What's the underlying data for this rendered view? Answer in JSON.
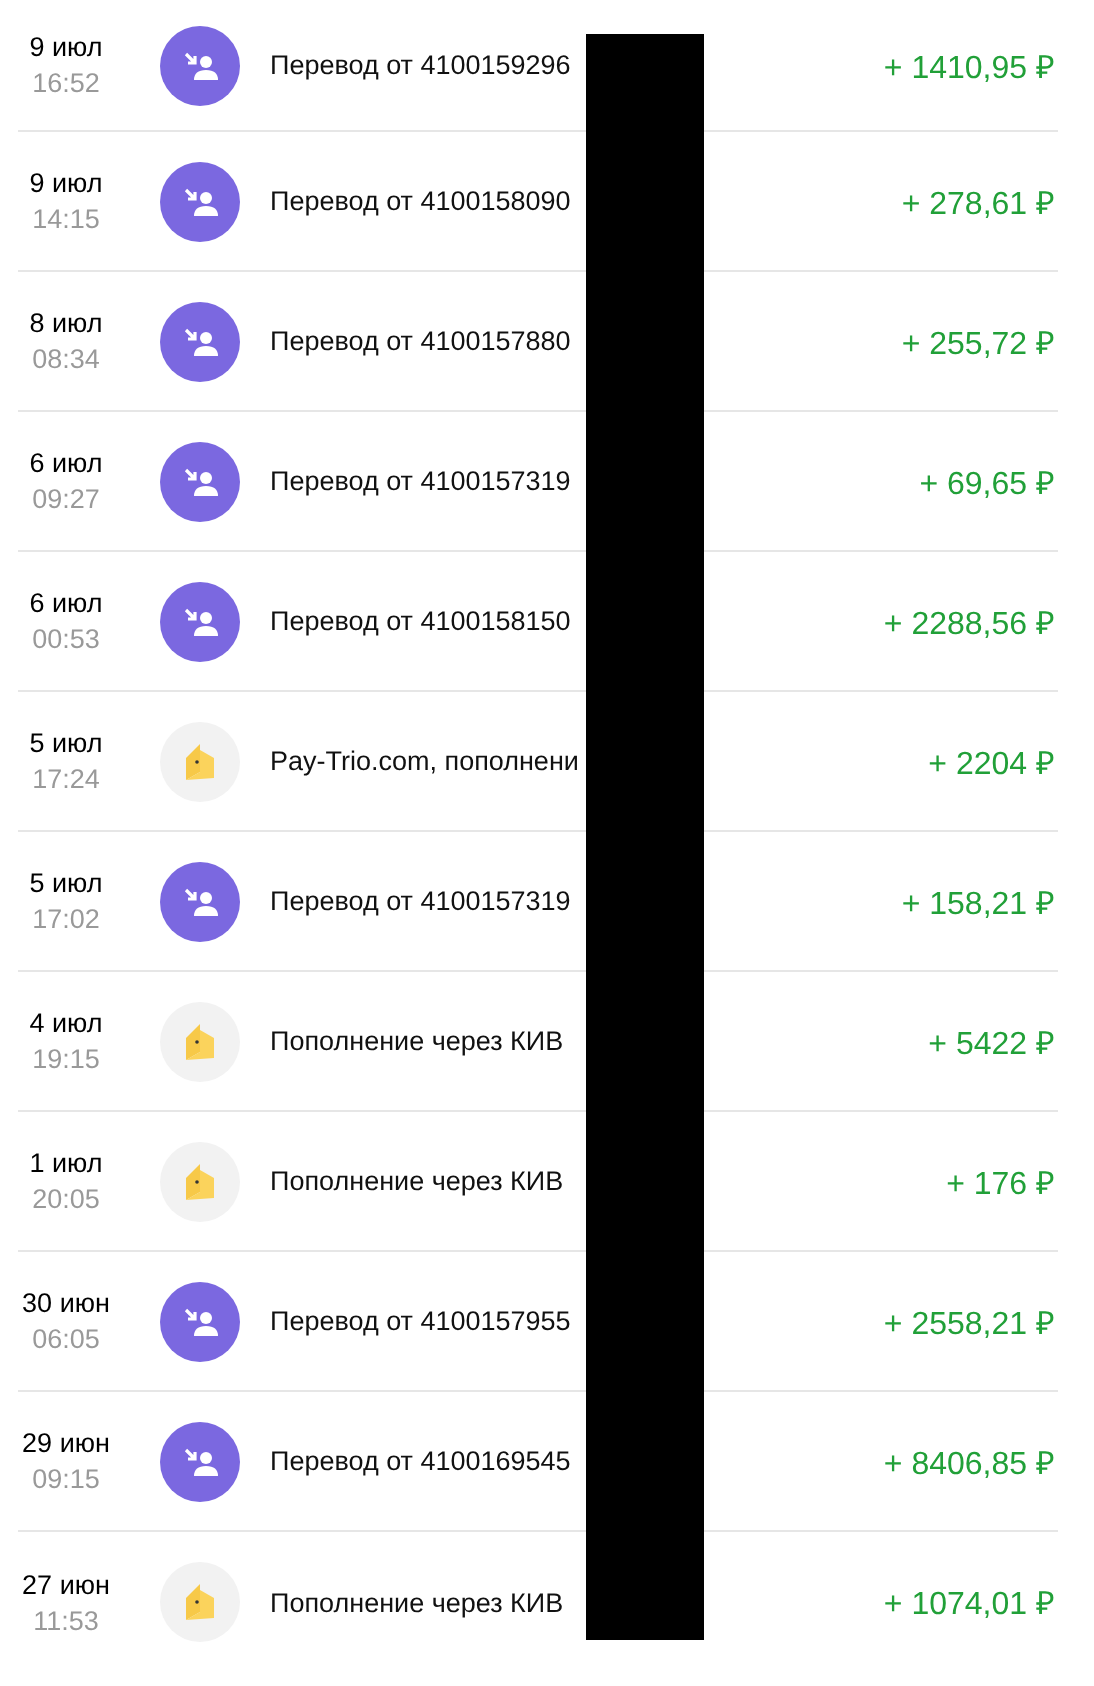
{
  "operations": [
    {
      "kind": "transfer",
      "date": "9 июл",
      "time": "16:52",
      "description": "Перевод от 4100159296",
      "amount": "+ 1410,95 ₽"
    },
    {
      "kind": "transfer",
      "date": "9 июл",
      "time": "14:15",
      "description": "Перевод от 4100158090",
      "amount": "+ 278,61 ₽"
    },
    {
      "kind": "transfer",
      "date": "8 июл",
      "time": "08:34",
      "description": "Перевод от 4100157880",
      "amount": "+ 255,72 ₽"
    },
    {
      "kind": "transfer",
      "date": "6 июл",
      "time": "09:27",
      "description": "Перевод от 4100157319",
      "amount": "+ 69,65 ₽"
    },
    {
      "kind": "transfer",
      "date": "6 июл",
      "time": "00:53",
      "description": "Перевод от 4100158150",
      "amount": "+ 2288,56 ₽"
    },
    {
      "kind": "topup",
      "date": "5 июл",
      "time": "17:24",
      "description": "Pay-Trio.com, пополнени",
      "amount": "+ 2204 ₽"
    },
    {
      "kind": "transfer",
      "date": "5 июл",
      "time": "17:02",
      "description": "Перевод от 4100157319",
      "amount": "+ 158,21 ₽"
    },
    {
      "kind": "topup",
      "date": "4 июл",
      "time": "19:15",
      "description": "Пополнение через КИВ",
      "amount": "+ 5422 ₽"
    },
    {
      "kind": "topup",
      "date": "1 июл",
      "time": "20:05",
      "description": "Пополнение через КИВ",
      "amount": "+ 176 ₽"
    },
    {
      "kind": "transfer",
      "date": "30 июн",
      "time": "06:05",
      "description": "Перевод от 4100157955",
      "amount": "+ 2558,21 ₽"
    },
    {
      "kind": "transfer",
      "date": "29 июн",
      "time": "09:15",
      "description": "Перевод от 4100169545",
      "amount": "+ 8406,85 ₽"
    },
    {
      "kind": "topup",
      "date": "27 июн",
      "time": "11:53",
      "description": "Пополнение через КИВ",
      "amount": "+ 1074,01 ₽"
    }
  ]
}
